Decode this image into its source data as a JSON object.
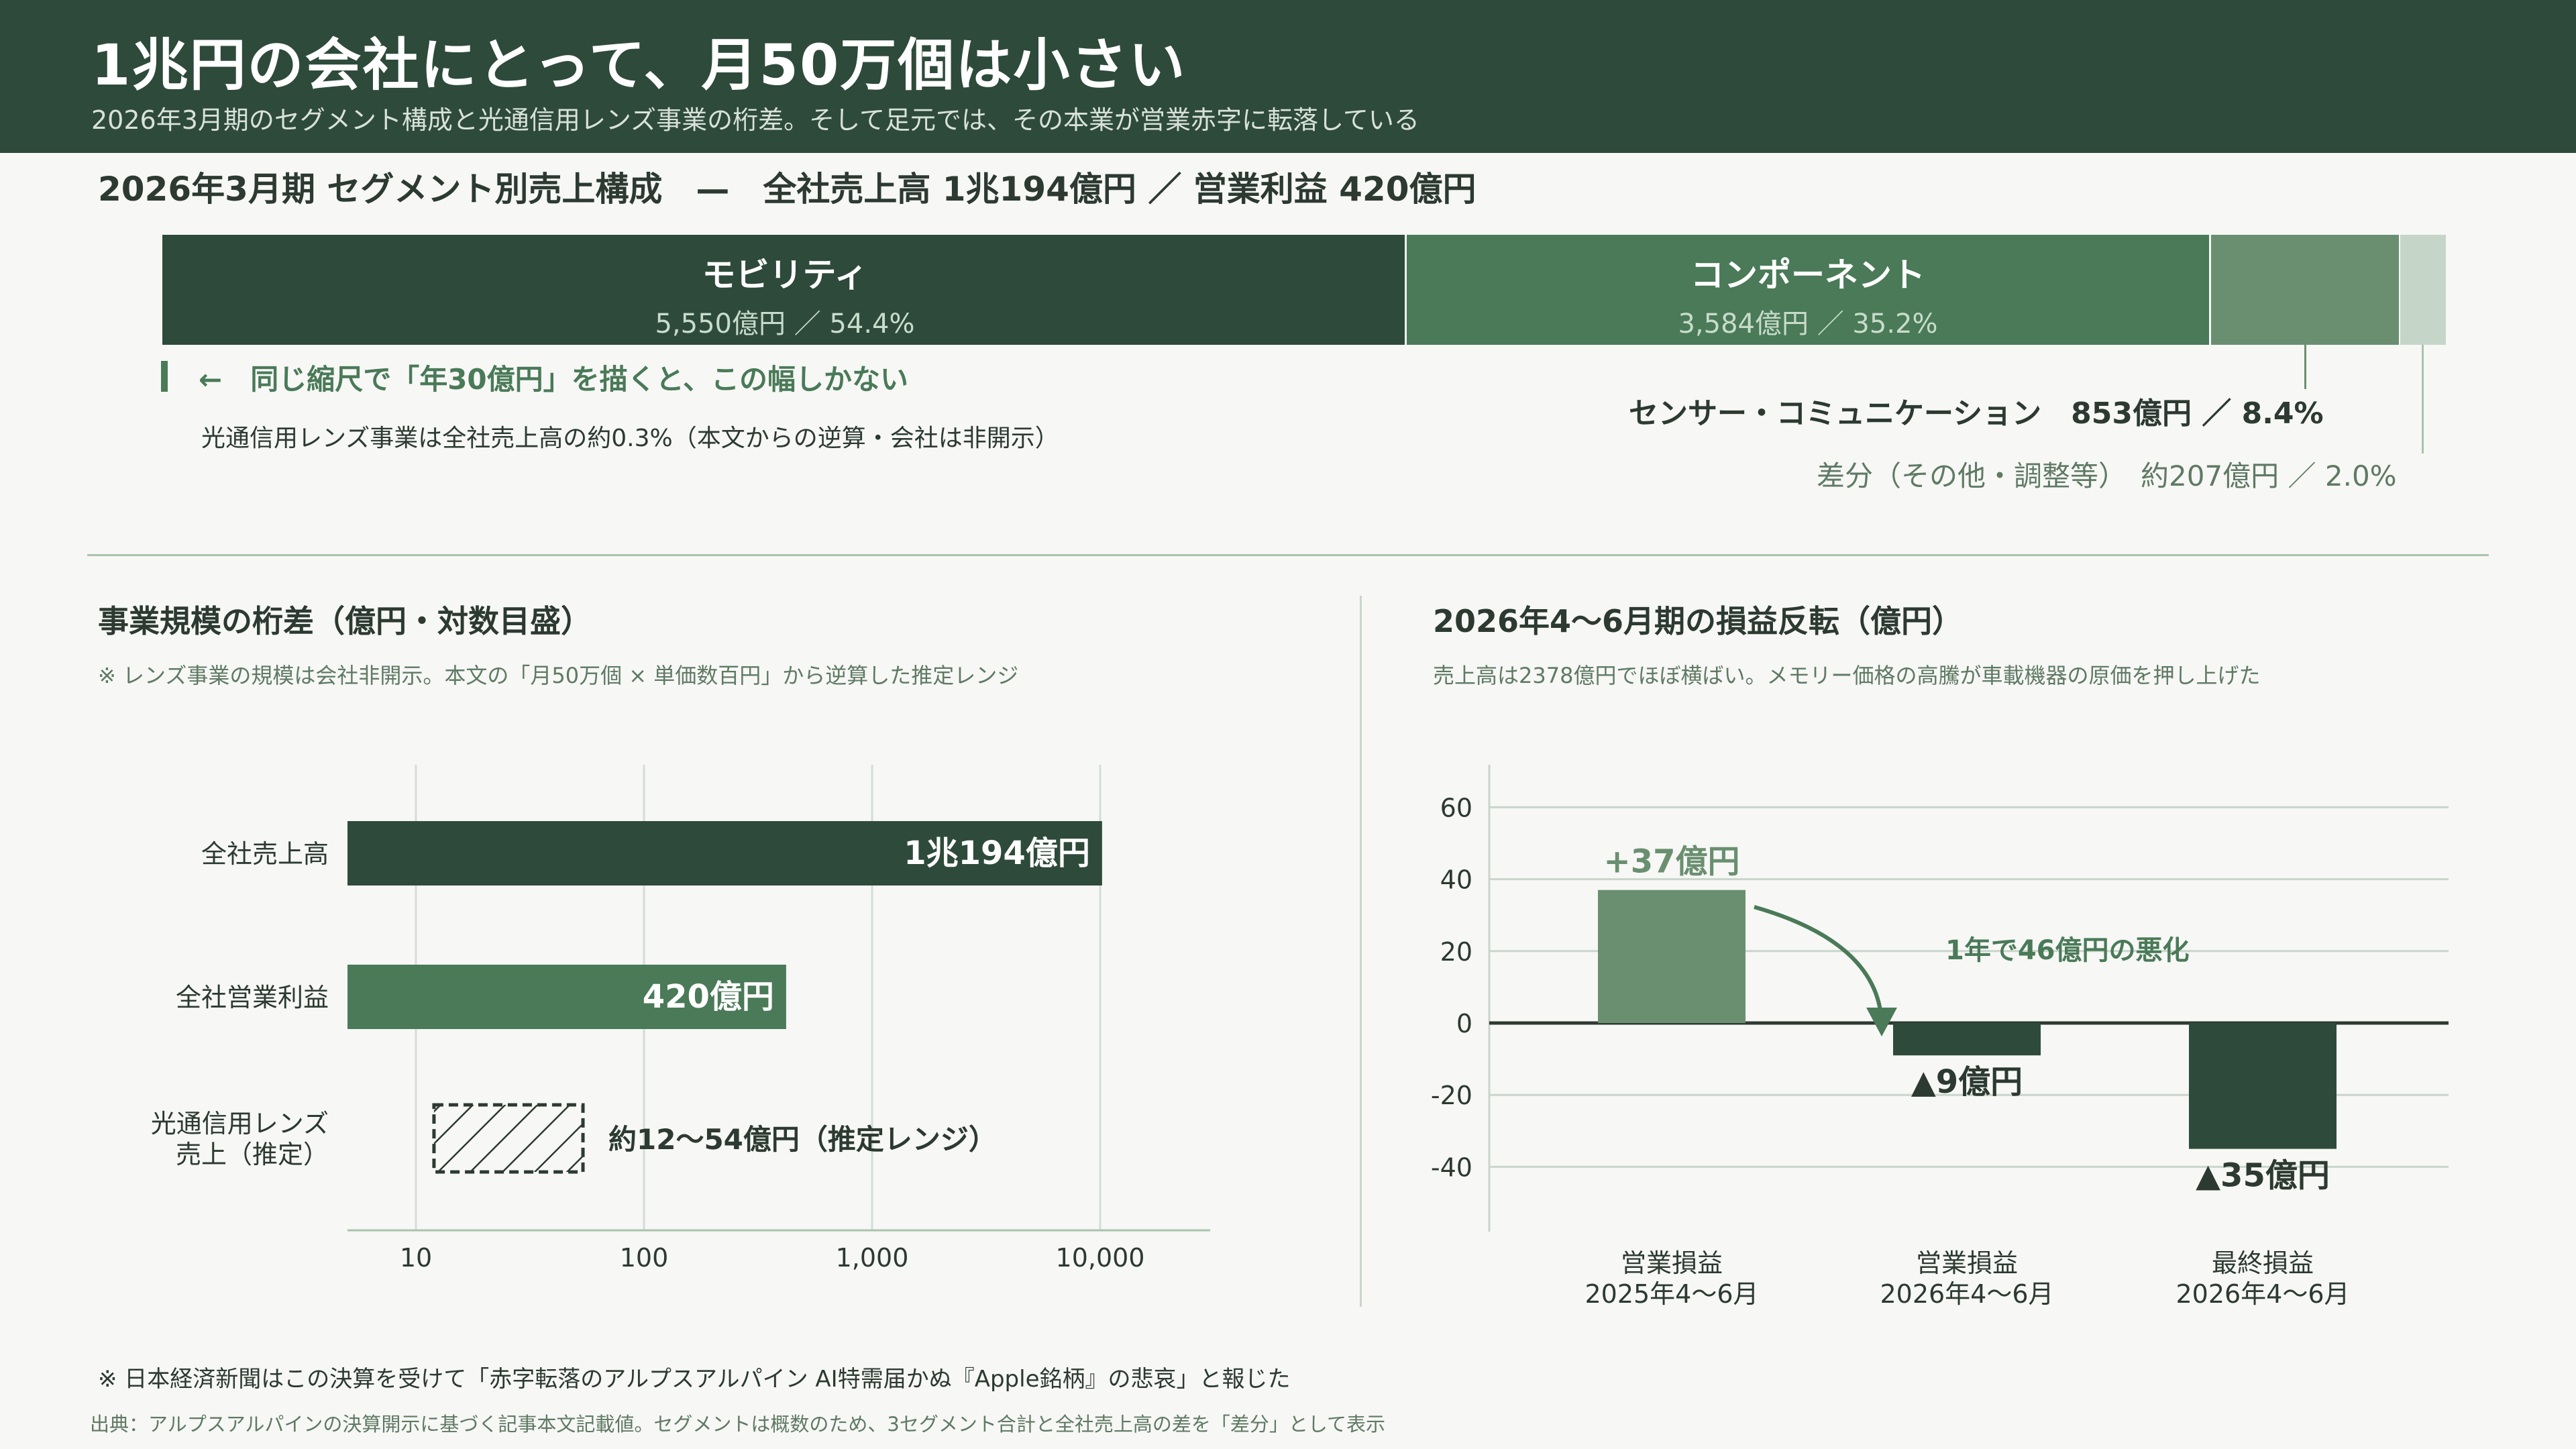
{
  "header": {
    "title": "1兆円の会社にとって、月50万個は小さい",
    "subtitle": "2026年3月期のセグメント構成と光通信用レンズ事業の桁差。そして足元では、その本業が営業赤字に転落している"
  },
  "composition": {
    "heading": "2026年3月期 セグメント別売上構成　—　全社売上高 1兆194億円 ／ 営業利益 420億円",
    "segments": [
      {
        "name": "モビリティ",
        "value_label": "5,550億円 ／ 54.4%",
        "amount": 5550,
        "share": 54.4,
        "color": "#2e4a3a"
      },
      {
        "name": "コンポーネント",
        "value_label": "3,584億円 ／ 35.2%",
        "amount": 3584,
        "share": 35.2,
        "color": "#4a7a58"
      },
      {
        "name": "センサー・コミュニケーション",
        "value_label": "853億円 ／ 8.4%",
        "amount": 853,
        "share": 8.4,
        "color": "#6a8f70"
      },
      {
        "name": "差分（その他・調整等）",
        "value_label": "約207億円 ／ 2.0%",
        "amount": 207,
        "share": 2.0,
        "color": "#c5d6c8"
      }
    ],
    "sensor_label": "センサー・コミュニケーション　853億円 ／ 8.4%",
    "other_label": "差分（その他・調整等）　約207億円 ／ 2.0%",
    "lens_arrow_note": "←　同じ縮尺で「年30億円」を描くと、この幅しかない",
    "lens_share_note": "光通信用レンズ事業は全社売上高の約0.3%（本文からの逆算・会社は非開示）"
  },
  "left_panel": {
    "title": "事業規模の桁差（億円・対数目盛）",
    "note": "※ レンズ事業の規模は会社非開示。本文の「月50万個 × 単価数百円」から逆算した推定レンジ"
  },
  "right_panel": {
    "title": "2026年4〜6月期の損益反転（億円）",
    "note": "売上高は2378億円でほぼ横ばい。メモリー価格の高騰が車載機器の原価を押し上げた",
    "annotation": "1年で46億円の悪化"
  },
  "chart_data": [
    {
      "type": "bar",
      "orientation": "horizontal",
      "title": "事業規模の桁差（億円・対数目盛）",
      "x_scale": "log",
      "xlim": [
        5,
        20000
      ],
      "x_ticks": [
        10,
        100,
        1000,
        10000
      ],
      "x_tick_labels": [
        "10",
        "100",
        "1,000",
        "10,000"
      ],
      "grid": true,
      "categories": [
        {
          "label_lines": [
            "全社売上高"
          ],
          "value": 10194,
          "label": "1兆194億円",
          "color": "#2e4a3a"
        },
        {
          "label_lines": [
            "全社営業利益"
          ],
          "value": 420,
          "label": "420億円",
          "color": "#4a7a58"
        },
        {
          "label_lines": [
            "光通信用レンズ",
            "売上（推定）"
          ],
          "range": [
            12,
            54
          ],
          "label": "約12〜54億円（推定レンジ）",
          "pattern": "hatched"
        }
      ]
    },
    {
      "type": "bar",
      "title": "2026年4〜6月期の損益反転（億円）",
      "ylim": [
        -50,
        65
      ],
      "y_ticks": [
        60,
        40,
        20,
        0,
        -20,
        -40
      ],
      "grid": true,
      "categories": [
        {
          "label_lines": [
            "営業損益",
            "2025年4〜6月"
          ],
          "value": 37,
          "label": "+37億円",
          "color": "#6a8f70"
        },
        {
          "label_lines": [
            "営業損益",
            "2026年4〜6月"
          ],
          "value": -9,
          "label": "▲9億円",
          "color": "#2e4a3a"
        },
        {
          "label_lines": [
            "最終損益",
            "2026年4〜6月"
          ],
          "value": -35,
          "label": "▲35億円",
          "color": "#2e4a3a"
        }
      ]
    }
  ],
  "footer": {
    "note": "※ 日本経済新聞はこの決算を受けて「赤字転落のアルプスアルパイン AI特需届かぬ『Apple銘柄』の悲哀」と報じた",
    "source": "出典：アルプスアルパインの決算開示に基づく記事本文記載値。セグメントは概数のため、3セグメント合計と全社売上高の差を「差分」として表示"
  }
}
